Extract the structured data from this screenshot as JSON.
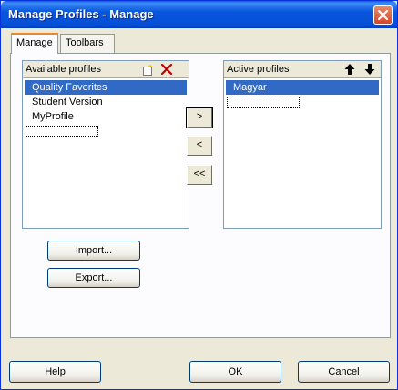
{
  "window": {
    "title": "Manage Profiles - Manage"
  },
  "tabs": [
    {
      "label": "Manage"
    },
    {
      "label": "Toolbars"
    }
  ],
  "available": {
    "label": "Available profiles",
    "items": [
      "Quality Favorites",
      "Student Version",
      "MyProfile"
    ],
    "selected_index": 0
  },
  "active": {
    "label": "Active profiles",
    "items": [
      "Magyar"
    ],
    "selected_index": 0
  },
  "transfer": {
    "add": ">",
    "remove": "<",
    "remove_all": "<<"
  },
  "buttons": {
    "import": "Import...",
    "export": "Export...",
    "help": "Help",
    "ok": "OK",
    "cancel": "Cancel"
  },
  "icons": {
    "new": "new-profile-icon",
    "delete": "delete-icon",
    "up": "arrow-up-icon",
    "down": "arrow-down-icon",
    "close": "close-icon"
  },
  "colors": {
    "title_bar": "#0855dd",
    "selection": "#316ac5",
    "delete_red": "#c00000"
  }
}
